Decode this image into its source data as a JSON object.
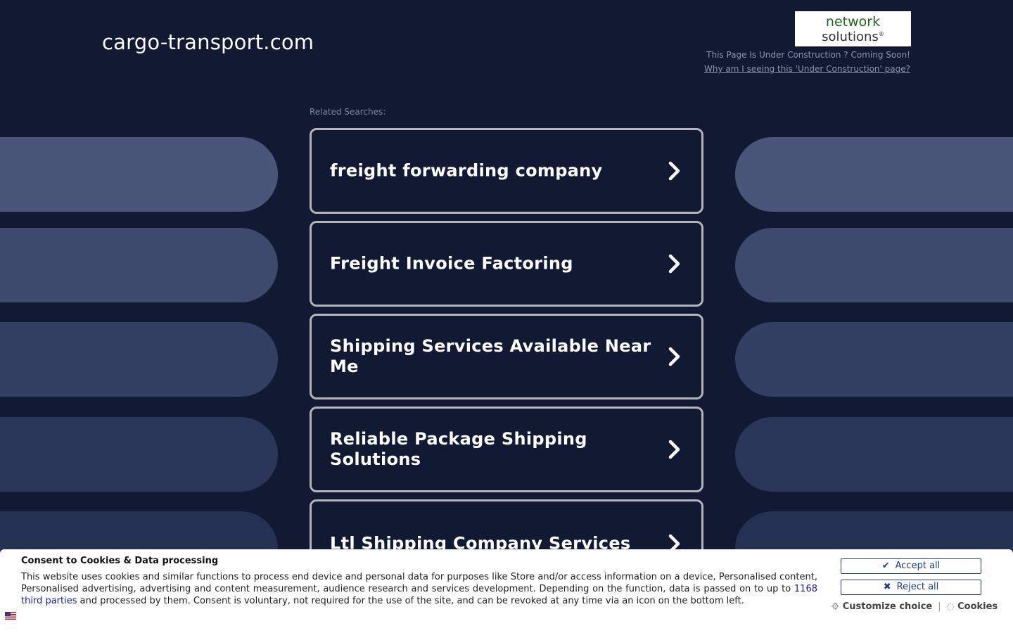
{
  "header": {
    "domain": "cargo-transport.com",
    "logo_line1": "network",
    "logo_line2": "solutions",
    "logo_mark": "®",
    "under_construction": "This Page Is Under Construction ? Coming Soon!",
    "why_link": "Why am I seeing this 'Under Construction' page?"
  },
  "related": {
    "label": "Related Searches:",
    "items": [
      {
        "label": "freight forwarding company"
      },
      {
        "label": "Freight Invoice Factoring"
      },
      {
        "label": "Shipping Services Available Near Me"
      },
      {
        "label": "Reliable Package Shipping Solutions"
      },
      {
        "label": "Ltl Shipping Company Services"
      }
    ]
  },
  "cookie": {
    "title": "Consent to Cookies & Data processing",
    "text_part1": "This website uses cookies and similar functions to process end device and personal data for purposes like Store and/or access information on a device, Personalised content, Personalised advertising, advertising and content measurement, audience research and services development. Depending on the function, data is passed on to up to ",
    "third_parties_link": "1168 third parties",
    "text_part2": " and processed by them. Consent is voluntary, not required for the use of the site, and can be revoked at any time via an icon on the bottom left.",
    "accept_label": "Accept all",
    "reject_label": "Reject all",
    "customize_label": "Customize choice",
    "cookies_label": "Cookies",
    "separator": "|",
    "icon_accept": "check-icon",
    "icon_reject": "x-icon",
    "icon_customize": "gear-icon",
    "icon_cookies": "cookie-icon",
    "language_flag": "us-flag-icon"
  },
  "colors": {
    "background": "#121a33",
    "card_border": "#b3b5bc",
    "button_border": "#1f3c8a"
  }
}
